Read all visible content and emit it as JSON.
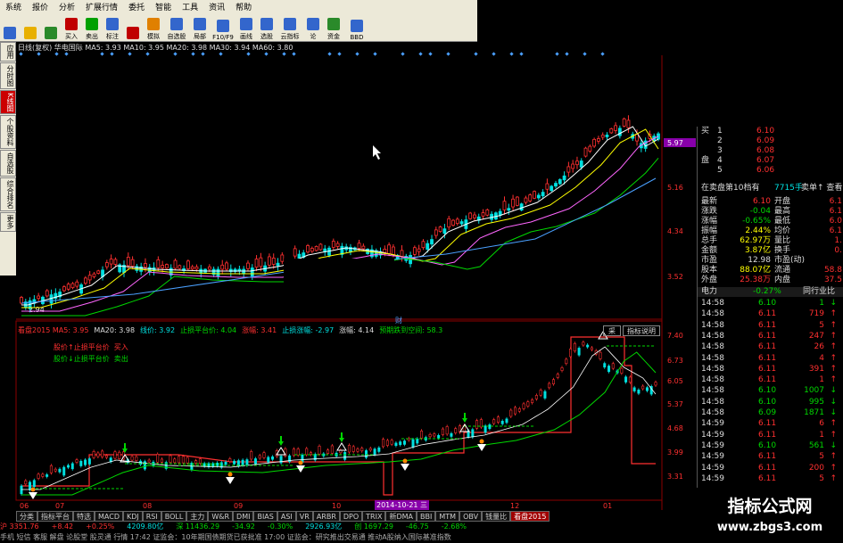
{
  "menu": [
    "系统",
    "报价",
    "分析",
    "扩展行情",
    "委托",
    "智能",
    "工具",
    "资讯",
    "帮助"
  ],
  "toolbar": [
    {
      "label": "",
      "icon": "grid-icon",
      "color": "#3366cc"
    },
    {
      "label": "",
      "icon": "back-arrow-icon",
      "color": "#e8b000"
    },
    {
      "label": "",
      "icon": "forward-arrow-icon",
      "color": "#2a8a2a"
    },
    {
      "label": "买入",
      "icon": "buy-icon",
      "color": "#c00000"
    },
    {
      "label": "卖出",
      "icon": "sell-icon",
      "color": "#00a000"
    },
    {
      "label": "标注",
      "icon": "mark-icon",
      "color": "#3366cc"
    },
    {
      "label": "",
      "icon": "wealth-icon",
      "color": "#c00000"
    },
    {
      "label": "模拟",
      "icon": "simulate-icon",
      "color": "#e08000"
    },
    {
      "label": "自选股",
      "icon": "watchlist-icon",
      "color": "#3366cc"
    },
    {
      "label": "局部",
      "icon": "zoom-icon",
      "color": "#3366cc"
    },
    {
      "label": "F10/F9",
      "icon": "f10-icon",
      "color": "#3366cc"
    },
    {
      "label": "画线",
      "icon": "draw-line-icon",
      "color": "#3366cc"
    },
    {
      "label": "选股",
      "icon": "stock-picker-icon",
      "color": "#3366cc"
    },
    {
      "label": "云指标",
      "icon": "cloud-indicator-icon",
      "color": "#3366cc"
    },
    {
      "label": "论",
      "icon": "forum-icon",
      "color": "#3366cc"
    },
    {
      "label": "资金",
      "icon": "funds-icon",
      "color": "#2a8a2a"
    },
    {
      "label": "BBD",
      "icon": "bbd-icon",
      "color": "#3366cc"
    }
  ],
  "left_tabs": [
    "应用",
    "分时图",
    "K线图",
    "个股资料",
    "自选股",
    "综合排名",
    "更多"
  ],
  "main_chart": {
    "info": "日线(复权)  华电国际  MA5: 3.93  MA10: 3.95  MA20: 3.98  MA30: 3.94  MA60: 3.80",
    "price_labels": [
      "5.97",
      "5.16",
      "4.34",
      "3.52"
    ],
    "current_price": "5.97",
    "low_label": "2.94",
    "corner_label": "财"
  },
  "sub_chart": {
    "info_parts": [
      {
        "t": "看盘2015  MA5: 3.95",
        "c": "#ff3030"
      },
      {
        "t": "MA20: 3.98",
        "c": "#dddddd"
      },
      {
        "t": "线价: 3.92",
        "c": "#00e0e0"
      },
      {
        "t": "止损平台价: 4.04",
        "c": "#00d800"
      },
      {
        "t": "涨幅: 3.41",
        "c": "#ff3030"
      },
      {
        "t": "止损涨幅: -2.97",
        "c": "#00e0e0"
      },
      {
        "t": "涨幅: 4.14",
        "c": "#dddddd"
      },
      {
        "t": "预期跌到空间: 58.3",
        "c": "#00d800"
      }
    ],
    "legend": [
      {
        "t": "股价↑止损平台价",
        "t2": "买入",
        "c": "#ff3030"
      },
      {
        "t": "股价↓止损平台价",
        "t2": "卖出",
        "c": "#00d800"
      }
    ],
    "price_labels": [
      "7.40",
      "6.73",
      "6.05",
      "5.37",
      "4.68",
      "3.99",
      "3.31"
    ],
    "tag1": "采",
    "tag2": "指标说明",
    "date_tag": "2014-10-21 三",
    "month_labels": [
      "06",
      "07",
      "08",
      "09",
      "10",
      "11",
      "12",
      "01"
    ]
  },
  "bottom_tabs": [
    "分类",
    "指标平台",
    "特选",
    "MACD",
    "KDJ",
    "RSI",
    "BOLL",
    "主力",
    "W&R",
    "DMI",
    "BIAS",
    "ASI",
    "VR",
    "ARBR",
    "DPO",
    "TRIX",
    "新DMA",
    "BBI",
    "MTM",
    "OBV",
    "钱量比",
    "看盘2015"
  ],
  "status": [
    {
      "t": "沪 3351.76",
      "c": "#ff3030"
    },
    {
      "t": "+8.42",
      "c": "#ff3030"
    },
    {
      "t": "+0.25%",
      "c": "#ff3030"
    },
    {
      "t": "4209.80亿",
      "c": "#00e0e0"
    },
    {
      "t": "深 11436.29",
      "c": "#00d800"
    },
    {
      "t": "-34.92",
      "c": "#00d800"
    },
    {
      "t": "-0.30%",
      "c": "#00d800"
    },
    {
      "t": "2926.93亿",
      "c": "#00e0e0"
    },
    {
      "t": "创 1697.29",
      "c": "#00d800"
    },
    {
      "t": "-46.75",
      "c": "#00d800"
    },
    {
      "t": "-2.68%",
      "c": "#00d800"
    }
  ],
  "ticker": "手机  短信  客服  解盘  论股堂  股灵通  行情    17:42 证监会：10年期国债期货已获批准      17:00 证监会：研究推出交易通  推动A股纳入国际基准指数",
  "order_book": [
    {
      "side": "买",
      "n": "1",
      "p": "6.10",
      "v": ""
    },
    {
      "side": "",
      "n": "2",
      "p": "6.09",
      "v": ""
    },
    {
      "side": "",
      "n": "3",
      "p": "6.08",
      "v": ""
    },
    {
      "side": "盘",
      "n": "4",
      "p": "6.07",
      "v": ""
    },
    {
      "side": "",
      "n": "5",
      "p": "6.06",
      "v": ""
    }
  ],
  "book_title": "在卖盘第10档有",
  "book_title_value": "7715手",
  "book_extra": "卖单↑  查看3",
  "stats": [
    {
      "l": "最新",
      "v": "6.10",
      "l2": "开盘",
      "c": "#ff3030"
    },
    {
      "l": "涨跌",
      "v": "-0.04",
      "l2": "最高",
      "c": "#00d800"
    },
    {
      "l": "涨幅",
      "v": "-0.65%",
      "l2": "最低",
      "c": "#00d800"
    },
    {
      "l": "振幅",
      "v": "2.44%",
      "l2": "均价",
      "c": "#ffff00"
    },
    {
      "l": "总手",
      "v": "62.97万",
      "l2": "量比",
      "c": "#ffff00"
    },
    {
      "l": "金额",
      "v": "3.87亿",
      "l2": "换手",
      "c": "#ffff00"
    },
    {
      "l": "市盈",
      "v": "12.98",
      "l2": "市盈(动)",
      "c": "#ddd"
    },
    {
      "l": "股本",
      "v": "88.07亿",
      "l2": "流通",
      "c": "#ffff00"
    },
    {
      "l": "外盘",
      "v": "25.38万",
      "l2": "内盘",
      "c": "#ff3030"
    }
  ],
  "stats_right": [
    "6.1",
    "6.1",
    "6.0",
    "6.1",
    "1.",
    "0.",
    "",
    "58.8",
    "37.5"
  ],
  "sector": {
    "name": "电力",
    "chg": "-0.27%",
    "link": "同行业比"
  },
  "ticks": [
    {
      "t": "14:58",
      "p": "6.10",
      "v": "1",
      "d": "down"
    },
    {
      "t": "14:58",
      "p": "6.11",
      "v": "719",
      "d": "up"
    },
    {
      "t": "14:58",
      "p": "6.11",
      "v": "5",
      "d": "up"
    },
    {
      "t": "14:58",
      "p": "6.11",
      "v": "247",
      "d": "up"
    },
    {
      "t": "14:58",
      "p": "6.11",
      "v": "26",
      "d": "up"
    },
    {
      "t": "14:58",
      "p": "6.11",
      "v": "4",
      "d": "up"
    },
    {
      "t": "14:58",
      "p": "6.11",
      "v": "391",
      "d": "up"
    },
    {
      "t": "14:58",
      "p": "6.11",
      "v": "1",
      "d": "up"
    },
    {
      "t": "14:58",
      "p": "6.10",
      "v": "1007",
      "d": "down"
    },
    {
      "t": "14:58",
      "p": "6.10",
      "v": "995",
      "d": "down"
    },
    {
      "t": "14:58",
      "p": "6.09",
      "v": "1871",
      "d": "down"
    },
    {
      "t": "14:59",
      "p": "6.11",
      "v": "6",
      "d": "up"
    },
    {
      "t": "14:59",
      "p": "6.11",
      "v": "1",
      "d": "up"
    },
    {
      "t": "14:59",
      "p": "6.10",
      "v": "561",
      "d": "down"
    },
    {
      "t": "14:59",
      "p": "6.11",
      "v": "5",
      "d": "up"
    },
    {
      "t": "14:59",
      "p": "6.11",
      "v": "200",
      "d": "up"
    },
    {
      "t": "14:59",
      "p": "6.11",
      "v": "5",
      "d": "up"
    },
    {
      "t": "14:59",
      "p": "6.11",
      "v": "4",
      "d": "up"
    },
    {
      "t": "14:59",
      "p": "6.11",
      "v": "68",
      "d": "up"
    },
    {
      "t": "14:59",
      "p": "6.11",
      "v": "13",
      "d": "up"
    },
    {
      "t": "14:59",
      "p": "6.11",
      "v": "4",
      "d": "up"
    },
    {
      "t": "15:00",
      "p": "6.10",
      "v": "10",
      "d": "down"
    }
  ],
  "watermark": {
    "line1": "指标公式网",
    "line2": "www.zbgs3.com"
  }
}
